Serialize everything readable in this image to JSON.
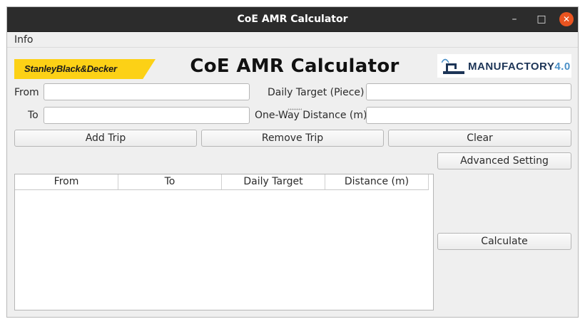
{
  "window": {
    "title": "CoE AMR Calculator",
    "controls": {
      "minimize": "–",
      "maximize": "□",
      "close": "✕"
    }
  },
  "menubar": {
    "items": [
      {
        "label": "Info"
      }
    ]
  },
  "header": {
    "title": "CoE AMR Calculator",
    "logo_left": "StanleyBlack&Decker",
    "logo_right_main": "MANUFACTORY",
    "logo_right_version": "4.0"
  },
  "form": {
    "from_label": "From",
    "to_label": "To",
    "daily_target_label": "Daily Target (Piece)",
    "distance_label": "One-Way Distance (m)",
    "from_value": "",
    "to_value": "",
    "daily_target_value": "",
    "distance_value": ""
  },
  "buttons": {
    "add_trip": "Add Trip",
    "remove_trip": "Remove Trip",
    "clear": "Clear",
    "advanced_setting": "Advanced Setting",
    "calculate": "Calculate"
  },
  "table": {
    "columns": [
      "From",
      "To",
      "Daily Target",
      "Distance (m)"
    ],
    "rows": []
  },
  "colors": {
    "titlebar": "#2c2c2c",
    "close_button": "#e95420",
    "sbd_yellow": "#fcd116",
    "window_bg": "#efefef"
  },
  "icons": {
    "logo_right": "robot-arm-icon"
  }
}
